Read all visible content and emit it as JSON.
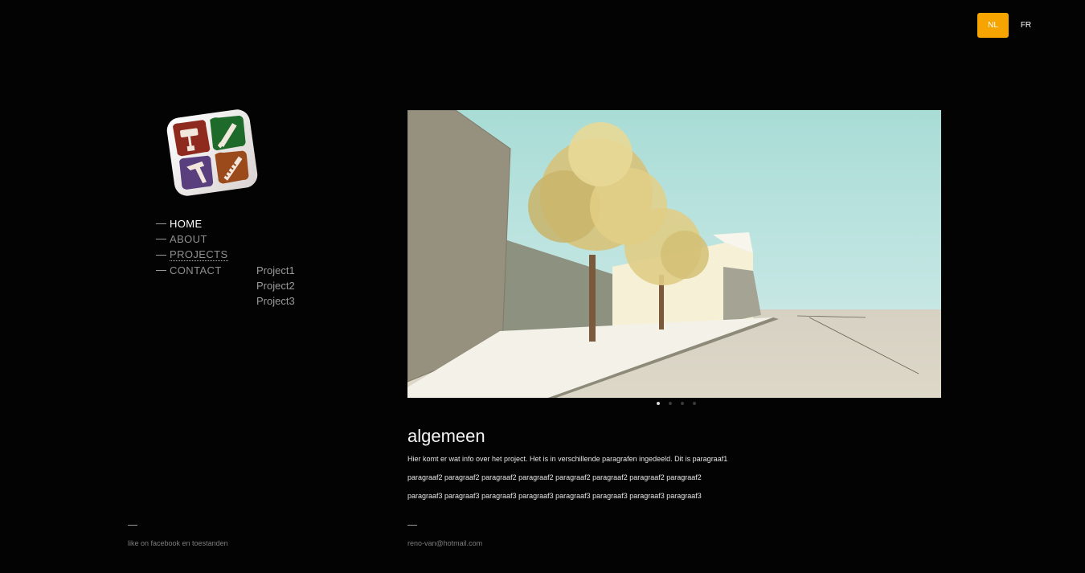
{
  "lang": {
    "nl": "NL",
    "fr": "FR",
    "active": "NL"
  },
  "nav": [
    {
      "label": "HOME"
    },
    {
      "label": "ABOUT"
    },
    {
      "label": "PROJECTS"
    },
    {
      "label": "CONTACT"
    }
  ],
  "projects_menu": [
    "Project1",
    "Project2",
    "Project3"
  ],
  "slideshow": {
    "slide_count": 4,
    "active_index": 0
  },
  "content": {
    "title": "algemeen",
    "paragraphs": [
      "Hier komt er wat info over het project. Het is in verschillende paragrafen ingedeeld. Dit is paragraaf1",
      "paragraaf2 paragraaf2 paragraaf2 paragraaf2 paragraaf2 paragraaf2 paragraaf2 paragraaf2",
      "paragraaf3 paragraaf3 paragraaf3 paragraaf3 paragraaf3 paragraaf3 paragraaf3 paragraaf3"
    ]
  },
  "footer": {
    "facebook": "like on facebook en toestanden",
    "email": "reno-van@hotmail.com"
  },
  "colors": {
    "accent": "#f5a400",
    "background": "#030303"
  },
  "icons": [
    "paint-roller-icon",
    "screwdriver-icon",
    "hammer-icon",
    "saw-icon",
    "tree-icon"
  ]
}
